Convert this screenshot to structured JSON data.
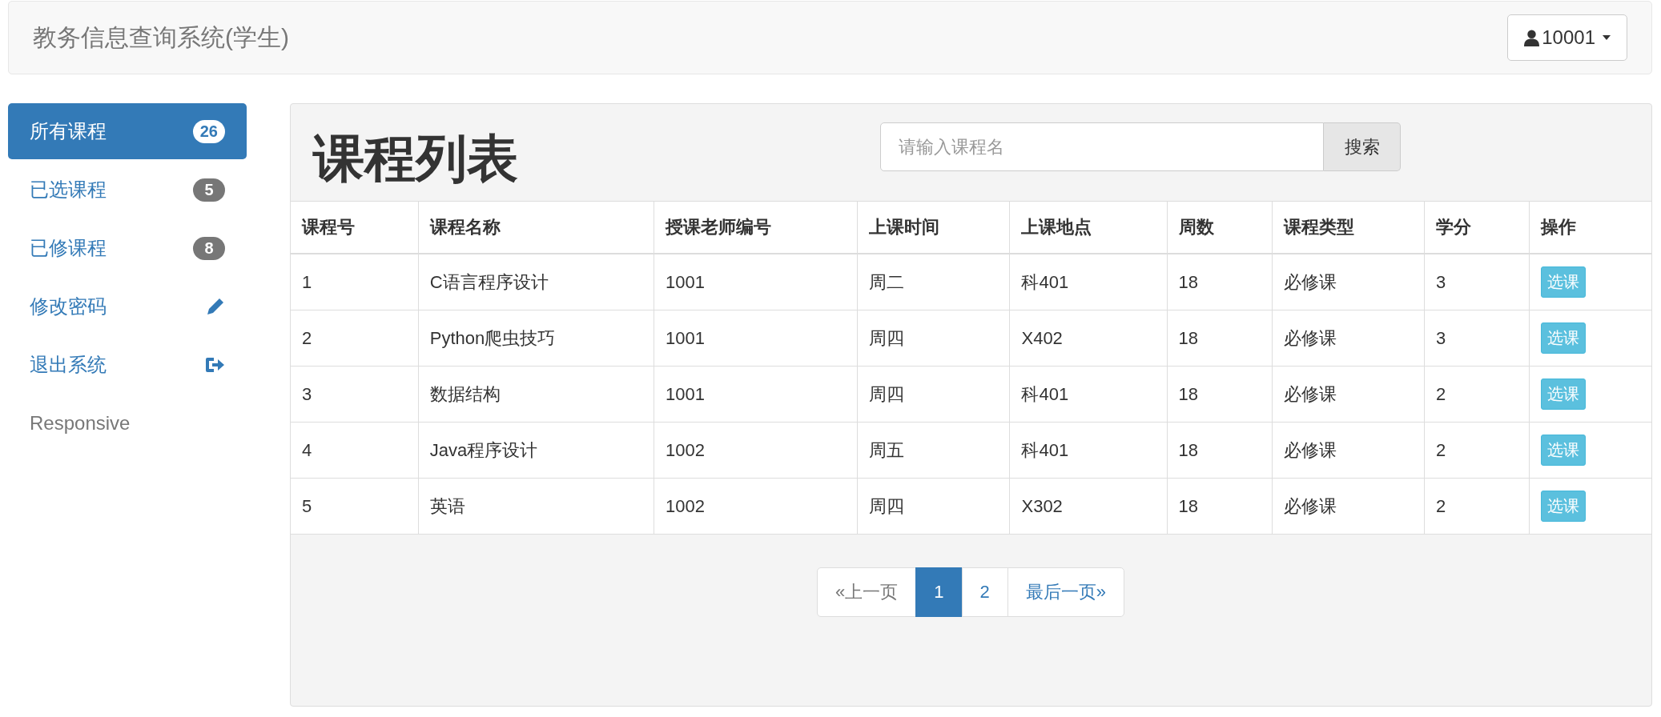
{
  "navbar": {
    "title": "教务信息查询系统(学生)",
    "user": "10001"
  },
  "sidebar": {
    "items": [
      {
        "label": "所有课程",
        "kind": "badge",
        "badge": "26",
        "selected": true,
        "disabled": false
      },
      {
        "label": "已选课程",
        "kind": "badge",
        "badge": "5",
        "selected": false,
        "disabled": false
      },
      {
        "label": "已修课程",
        "kind": "badge",
        "badge": "8",
        "selected": false,
        "disabled": false
      },
      {
        "label": "修改密码",
        "kind": "edit",
        "selected": false,
        "disabled": false
      },
      {
        "label": "退出系统",
        "kind": "logout",
        "selected": false,
        "disabled": false
      },
      {
        "label": "Responsive",
        "kind": "plain",
        "selected": false,
        "disabled": true
      }
    ]
  },
  "panel": {
    "title": "课程列表",
    "search": {
      "placeholder": "请输入课程名",
      "button": "搜索"
    }
  },
  "table": {
    "columns": [
      "课程号",
      "课程名称",
      "授课老师编号",
      "上课时间",
      "上课地点",
      "周数",
      "课程类型",
      "学分",
      "操作"
    ],
    "rows": [
      {
        "cells": [
          "1",
          "C语言程序设计",
          "1001",
          "周二",
          "科401",
          "18",
          "必修课",
          "3"
        ],
        "action": "选课"
      },
      {
        "cells": [
          "2",
          "Python爬虫技巧",
          "1001",
          "周四",
          "X402",
          "18",
          "必修课",
          "3"
        ],
        "action": "选课"
      },
      {
        "cells": [
          "3",
          "数据结构",
          "1001",
          "周四",
          "科401",
          "18",
          "必修课",
          "2"
        ],
        "action": "选课"
      },
      {
        "cells": [
          "4",
          "Java程序设计",
          "1002",
          "周五",
          "科401",
          "18",
          "必修课",
          "2"
        ],
        "action": "选课"
      },
      {
        "cells": [
          "5",
          "英语",
          "1002",
          "周四",
          "X302",
          "18",
          "必修课",
          "2"
        ],
        "action": "选课"
      }
    ]
  },
  "pagination": [
    {
      "label": "«上一页",
      "selected": false,
      "disabled": true
    },
    {
      "label": "1",
      "selected": true,
      "disabled": false
    },
    {
      "label": "2",
      "selected": false,
      "disabled": false
    },
    {
      "label": "最后一页»",
      "selected": false,
      "disabled": false
    }
  ]
}
